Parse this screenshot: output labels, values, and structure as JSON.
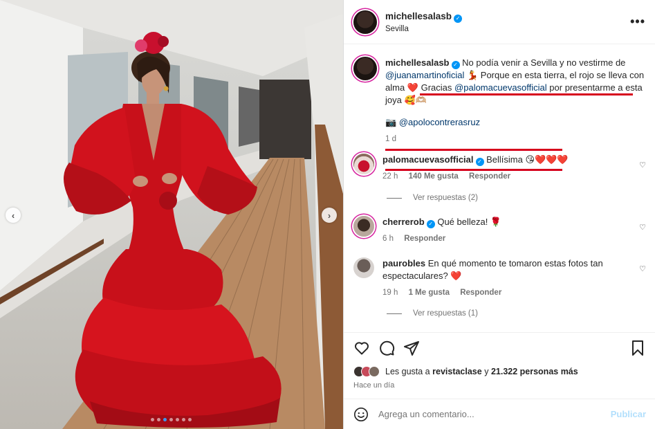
{
  "photo": {
    "prev_arrow": "‹",
    "next_arrow": "›",
    "dots_total": 7,
    "dots_active_index": 2
  },
  "post": {
    "author": "michellesalasb",
    "location": "Sevilla",
    "more": "•••",
    "verified_mark": "✓"
  },
  "caption": {
    "username": "michellesalasb",
    "text_1": "No podía venir a Sevilla y no vestirme de",
    "mention_1": "@juanamartinoficial",
    "text_2": "💃 Porque en esta tierra, el rojo se lleva con alma ❤️",
    "text_3": "Gracias",
    "mention_2": "@palomacuevasofficial",
    "text_4": "por presentarme a esta joya 🥰🫶🏼",
    "credit_icon": "📷",
    "credit": "@apolocontrerasruz",
    "time": "1 d"
  },
  "comments": [
    {
      "username": "palomacuevasofficial",
      "verified": true,
      "text": "Bellísima 😘❤️❤️❤️",
      "time": "22 h",
      "likes": "140 Me gusta",
      "reply": "Responder",
      "view_replies": "Ver respuestas (2)"
    },
    {
      "username": "cherrerob",
      "verified": true,
      "text": "Qué belleza! 🌹",
      "time": "6 h",
      "reply": "Responder"
    },
    {
      "username": "paurobles",
      "verified": false,
      "text": "En qué momento te tomaron estas fotos tan espectaculares? ❤️",
      "time": "19 h",
      "likes": "1 Me gusta",
      "reply": "Responder",
      "view_replies": "Ver respuestas (1)"
    }
  ],
  "likes_line": {
    "prefix": "Les gusta a",
    "user": "revistaclase",
    "and": "y",
    "others": "21.322 personas más",
    "time_ago": "Hace un día"
  },
  "composer": {
    "placeholder": "Agrega un comentario...",
    "publish": "Publicar"
  },
  "icons": {
    "like": "heart-icon",
    "comment": "comment-icon",
    "share": "share-icon",
    "save": "bookmark-icon",
    "emoji": "emoji-icon"
  },
  "colors": {
    "dress_red": "#d0101b",
    "accent_blue": "#0095f6",
    "link_blue": "#00376b",
    "annotation_red": "#d6001c",
    "publish_disabled": "#b2dffc"
  }
}
